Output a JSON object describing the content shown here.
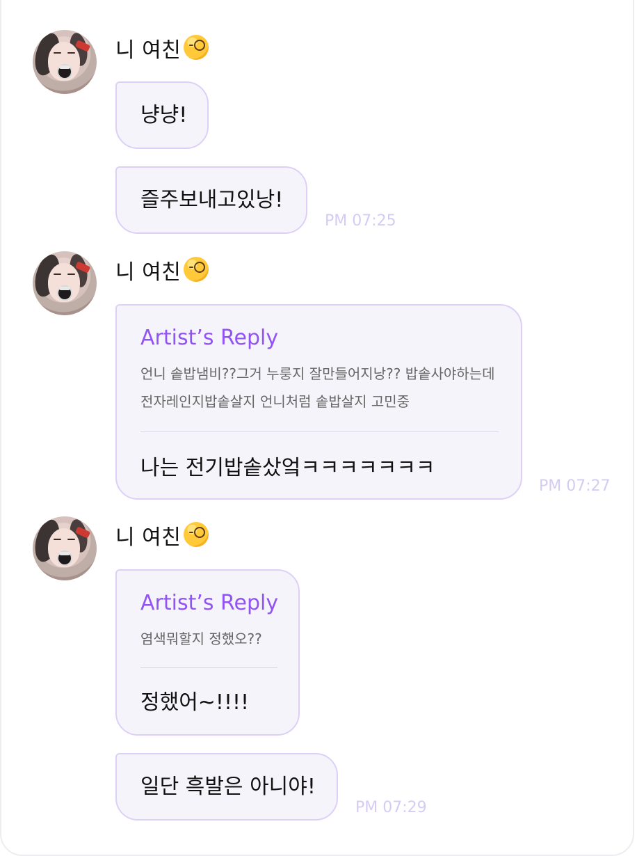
{
  "chat": {
    "sender": {
      "name": "니 여친",
      "emoji_name": "monocle-face"
    },
    "messages": [
      {
        "text": "냥냥!"
      },
      {
        "text": "즐주보내고있낭!",
        "time": "PM 07:25"
      },
      {
        "reply_title": "Artist’s Reply",
        "quote": "언니 솥밥냄비??그거 누룽지 잘만들어지낭?? 밥솥사야하는데 전자레인지밥솥살지 언니처럼 솥밥살지 고민중",
        "answer": "나는 전기밥솥샀엌ㅋㅋㅋㅋㅋㅋㅋ",
        "time": "PM 07:27"
      },
      {
        "reply_title": "Artist’s Reply",
        "quote": "염색뭐할지 정했오??",
        "answer": "정했어~!!!!"
      },
      {
        "text": "일단 흑발은 아니야!",
        "time": "PM 07:29"
      }
    ]
  },
  "colors": {
    "accent": "#9154f3",
    "bubble_border": "#ddd0f7",
    "bubble_background": "#f5f4fb",
    "timestamp": "#d5ccf4"
  }
}
